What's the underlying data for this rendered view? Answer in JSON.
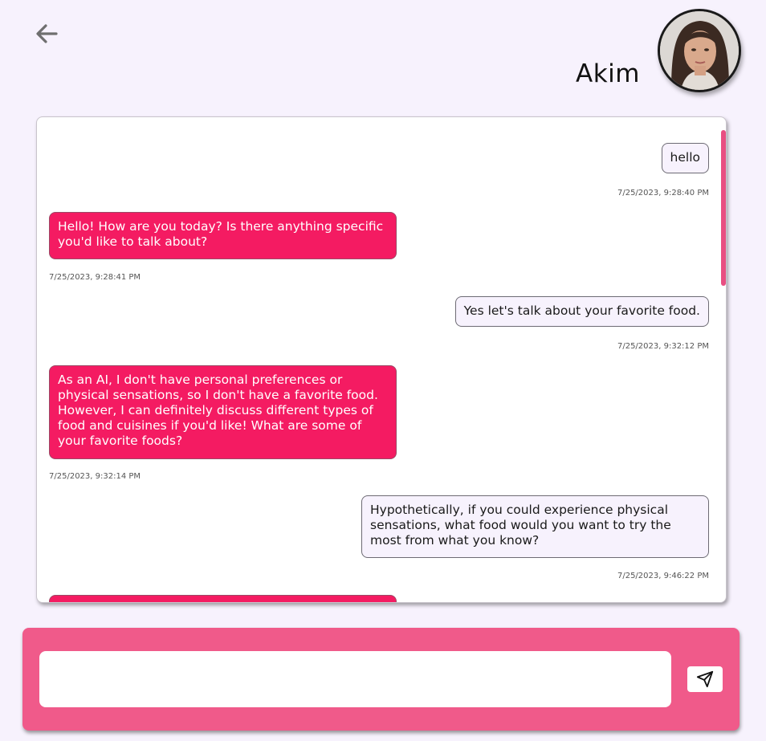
{
  "header": {
    "contact_name": "Akim"
  },
  "colors": {
    "background": "#f7f2fd",
    "ai_bubble": "#f41b62",
    "user_bubble": "#f7f2fd",
    "composer": "#f05a8a"
  },
  "icons": {
    "back": "arrow-left-icon",
    "send": "paper-plane-icon"
  },
  "messages": [
    {
      "sender": "user",
      "text": "hello",
      "timestamp": "7/25/2023, 9:28:40 PM"
    },
    {
      "sender": "ai",
      "text": "Hello! How are you today? Is there anything specific you'd like to talk about?",
      "timestamp": "7/25/2023, 9:28:41 PM"
    },
    {
      "sender": "user",
      "text": "Yes let's talk about your favorite food.",
      "timestamp": "7/25/2023, 9:32:12 PM"
    },
    {
      "sender": "ai",
      "text": "As an AI, I don't have personal preferences or physical sensations, so I don't have a favorite food. However, I can definitely discuss different types of food and cuisines if you'd like! What are some of your favorite foods?",
      "timestamp": "7/25/2023, 9:32:14 PM"
    },
    {
      "sender": "user",
      "text": "Hypothetically, if you could experience physical sensations, what food would you want to try the most from what you know?",
      "timestamp": "7/25/2023, 9:46:22 PM"
    },
    {
      "sender": "ai",
      "text": ""
    }
  ],
  "composer": {
    "input_value": "",
    "input_placeholder": ""
  }
}
